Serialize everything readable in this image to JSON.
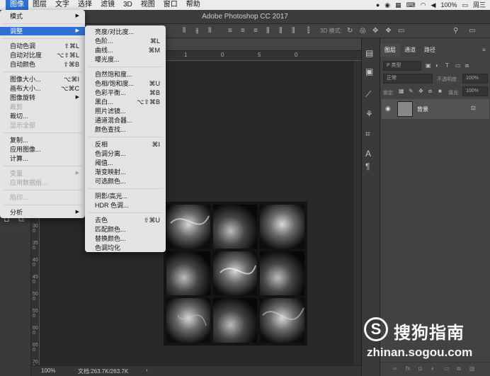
{
  "menubar": {
    "items": [
      "图像",
      "图层",
      "文字",
      "选择",
      "滤镜",
      "3D",
      "视图",
      "窗口",
      "帮助"
    ],
    "active_index": 0,
    "right": {
      "battery": "100%",
      "day": "周三"
    }
  },
  "window": {
    "title": "Adobe Photoshop CC 2017"
  },
  "options": {
    "mode_label": "3D 模式:"
  },
  "ruler": {
    "top_ticks": [
      "00",
      "5",
      "0",
      "0",
      "1",
      "0",
      "5",
      "0"
    ],
    "left_ticks": [
      "300",
      "350",
      "400",
      "450",
      "500",
      "550",
      "600",
      "650",
      "700"
    ]
  },
  "status": {
    "zoom": "100%",
    "doc": "文档:263.7K/263.7K",
    "arrow": "›"
  },
  "layers": {
    "tabs": [
      "图层",
      "通道",
      "路径"
    ],
    "filter_label": "P 类型",
    "blend_mode": "正常",
    "opacity_label": "不透明度:",
    "opacity_value": "100%",
    "lock_label": "锁定:",
    "fill_label": "填充:",
    "fill_value": "100%",
    "layer_name": "背景"
  },
  "watermark": {
    "logo": "S",
    "brand": "搜狗指南",
    "url": "zhinan.sogou.com"
  },
  "image_menu": {
    "items": [
      {
        "label": "模式",
        "submenu": true
      },
      {
        "label": "调整",
        "submenu": true,
        "highlight": true
      },
      {
        "label": "自动色调",
        "shortcut": "⇧⌘L"
      },
      {
        "label": "自动对比度",
        "shortcut": "⌥⇧⌘L"
      },
      {
        "label": "自动颜色",
        "shortcut": "⇧⌘B"
      },
      {
        "label": "图像大小...",
        "shortcut": "⌥⌘I"
      },
      {
        "label": "画布大小...",
        "shortcut": "⌥⌘C"
      },
      {
        "label": "图像旋转",
        "submenu": true
      },
      {
        "label": "裁剪",
        "disabled": true
      },
      {
        "label": "裁切..."
      },
      {
        "label": "显示全部",
        "disabled": true
      },
      {
        "label": "复制..."
      },
      {
        "label": "应用图像..."
      },
      {
        "label": "计算..."
      },
      {
        "label": "变量",
        "submenu": true,
        "disabled": true
      },
      {
        "label": "应用数据组...",
        "disabled": true
      },
      {
        "label": "陷印...",
        "disabled": true
      },
      {
        "label": "分析",
        "submenu": true
      }
    ]
  },
  "adjust_menu": {
    "items": [
      {
        "label": "亮度/对比度..."
      },
      {
        "label": "色阶...",
        "shortcut": "⌘L"
      },
      {
        "label": "曲线...",
        "shortcut": "⌘M"
      },
      {
        "label": "曝光度..."
      },
      {
        "label": "自然饱和度..."
      },
      {
        "label": "色相/饱和度...",
        "shortcut": "⌘U"
      },
      {
        "label": "色彩平衡...",
        "shortcut": "⌘B"
      },
      {
        "label": "黑白...",
        "shortcut": "⌥⇧⌘B"
      },
      {
        "label": "照片滤镜..."
      },
      {
        "label": "通道混合器..."
      },
      {
        "label": "颜色查找..."
      },
      {
        "label": "反相",
        "shortcut": "⌘I"
      },
      {
        "label": "色调分离..."
      },
      {
        "label": "阈值..."
      },
      {
        "label": "渐变映射..."
      },
      {
        "label": "可选颜色..."
      },
      {
        "label": "阴影/高光..."
      },
      {
        "label": "HDR 色调..."
      },
      {
        "label": "去色",
        "shortcut": "⇧⌘U"
      },
      {
        "label": "匹配颜色..."
      },
      {
        "label": "替换颜色..."
      },
      {
        "label": "色调均化"
      }
    ]
  },
  "colors": {
    "highlight": "#2f6fd6",
    "menu_bg": "#e9e9ec",
    "ui_dark": "#424242"
  }
}
